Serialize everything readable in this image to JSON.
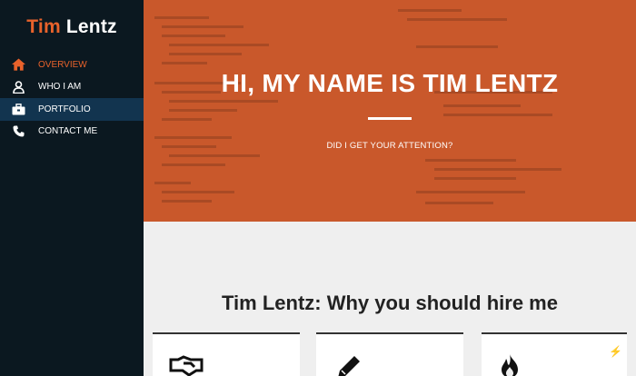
{
  "sidebar": {
    "brand": {
      "first": "Tim",
      "last": "Lentz"
    },
    "items": [
      {
        "label": "OVERVIEW",
        "icon": "home-icon"
      },
      {
        "label": "WHO I AM",
        "icon": "user-icon"
      },
      {
        "label": "PORTFOLIO",
        "icon": "briefcase-icon"
      },
      {
        "label": "CONTACT ME",
        "icon": "phone-icon"
      }
    ]
  },
  "hero": {
    "title": "HI, MY NAME IS TIM LENTZ",
    "subtitle": "DID I GET YOUR ATTENTION?"
  },
  "section": {
    "title": "Tim Lentz: Why you should hire me"
  },
  "cards": [
    {
      "icon": "handshake-icon"
    },
    {
      "icon": "pencil-icon"
    },
    {
      "icon": "fire-icon"
    }
  ],
  "colors": {
    "accent": "#e8622b",
    "sidebar": "#0b1820",
    "active": "#12344f",
    "hero": "#c9582b"
  }
}
